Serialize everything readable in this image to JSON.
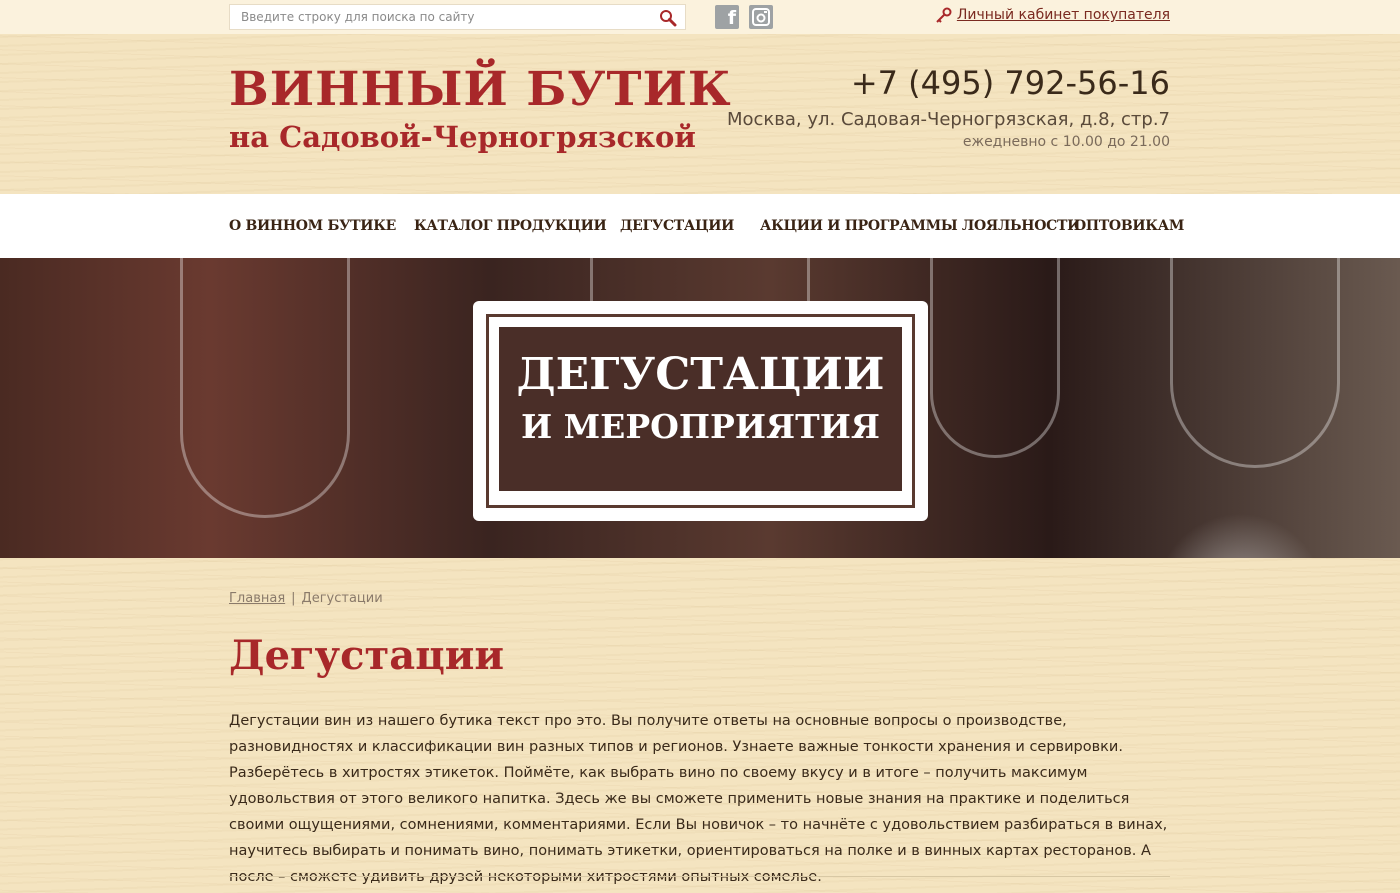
{
  "topbar": {
    "search_placeholder": "Введите строку для поиска по сайту",
    "cabinet_label": "Личный кабинет покупателя",
    "social": [
      {
        "icon": "facebook-icon",
        "glyph": "f"
      },
      {
        "icon": "instagram-icon",
        "glyph": "◙"
      }
    ]
  },
  "header": {
    "logo_line1": "ВИННЫЙ БУТИК",
    "logo_line2": "на Садовой-Черногрязской",
    "phone": "+7 (495) 792-56-16",
    "address": "Москва, ул. Садовая-Черногрязская, д.8, стр.7",
    "hours": "ежедневно с 10.00 до 21.00"
  },
  "nav": {
    "items": [
      {
        "label": "О ВИННОМ БУТИКЕ"
      },
      {
        "label": "КАТАЛОГ ПРОДУКЦИИ"
      },
      {
        "label": "ДЕГУСТАЦИИ"
      },
      {
        "label": "АКЦИИ И ПРОГРАММЫ ЛОЯЛЬНОСТИ"
      },
      {
        "label": "ОПТОВИКАМ"
      }
    ]
  },
  "banner": {
    "title_line1": "ДЕГУСТАЦИИ",
    "title_line2": "И МЕРОПРИЯТИЯ"
  },
  "breadcrumb": {
    "home": "Главная",
    "separator": "|",
    "current": "Дегустации"
  },
  "main": {
    "title": "Дегустации",
    "text": "Дегустации вин из нашего бутика текст про это.  Вы получите ответы на основные вопросы о производстве, разновидностях и классификации вин разных типов и регионов. Узнаете важные тонкости хранения и сервировки. Разберётесь в хитростях этикеток. Поймёте, как выбрать вино по своему вкусу и в итоге – получить максимум удовольствия от этого великого напитка. Здесь же вы сможете применить новые знания на практике и поделиться своими ощущениями, сомнениями, комментариями. Если Вы новичок – то начнёте с удовольствием разбираться в винах, научитесь выбирать и понимать вино, понимать этикетки, ориентироваться на полке и в винных картах ресторанов. А после – сможете удивить друзей некоторыми хитростями опытных сомелье."
  },
  "colors": {
    "brand_red": "#a8282a",
    "page_bg": "#f4e4c0",
    "nav_text": "#3a2414"
  }
}
